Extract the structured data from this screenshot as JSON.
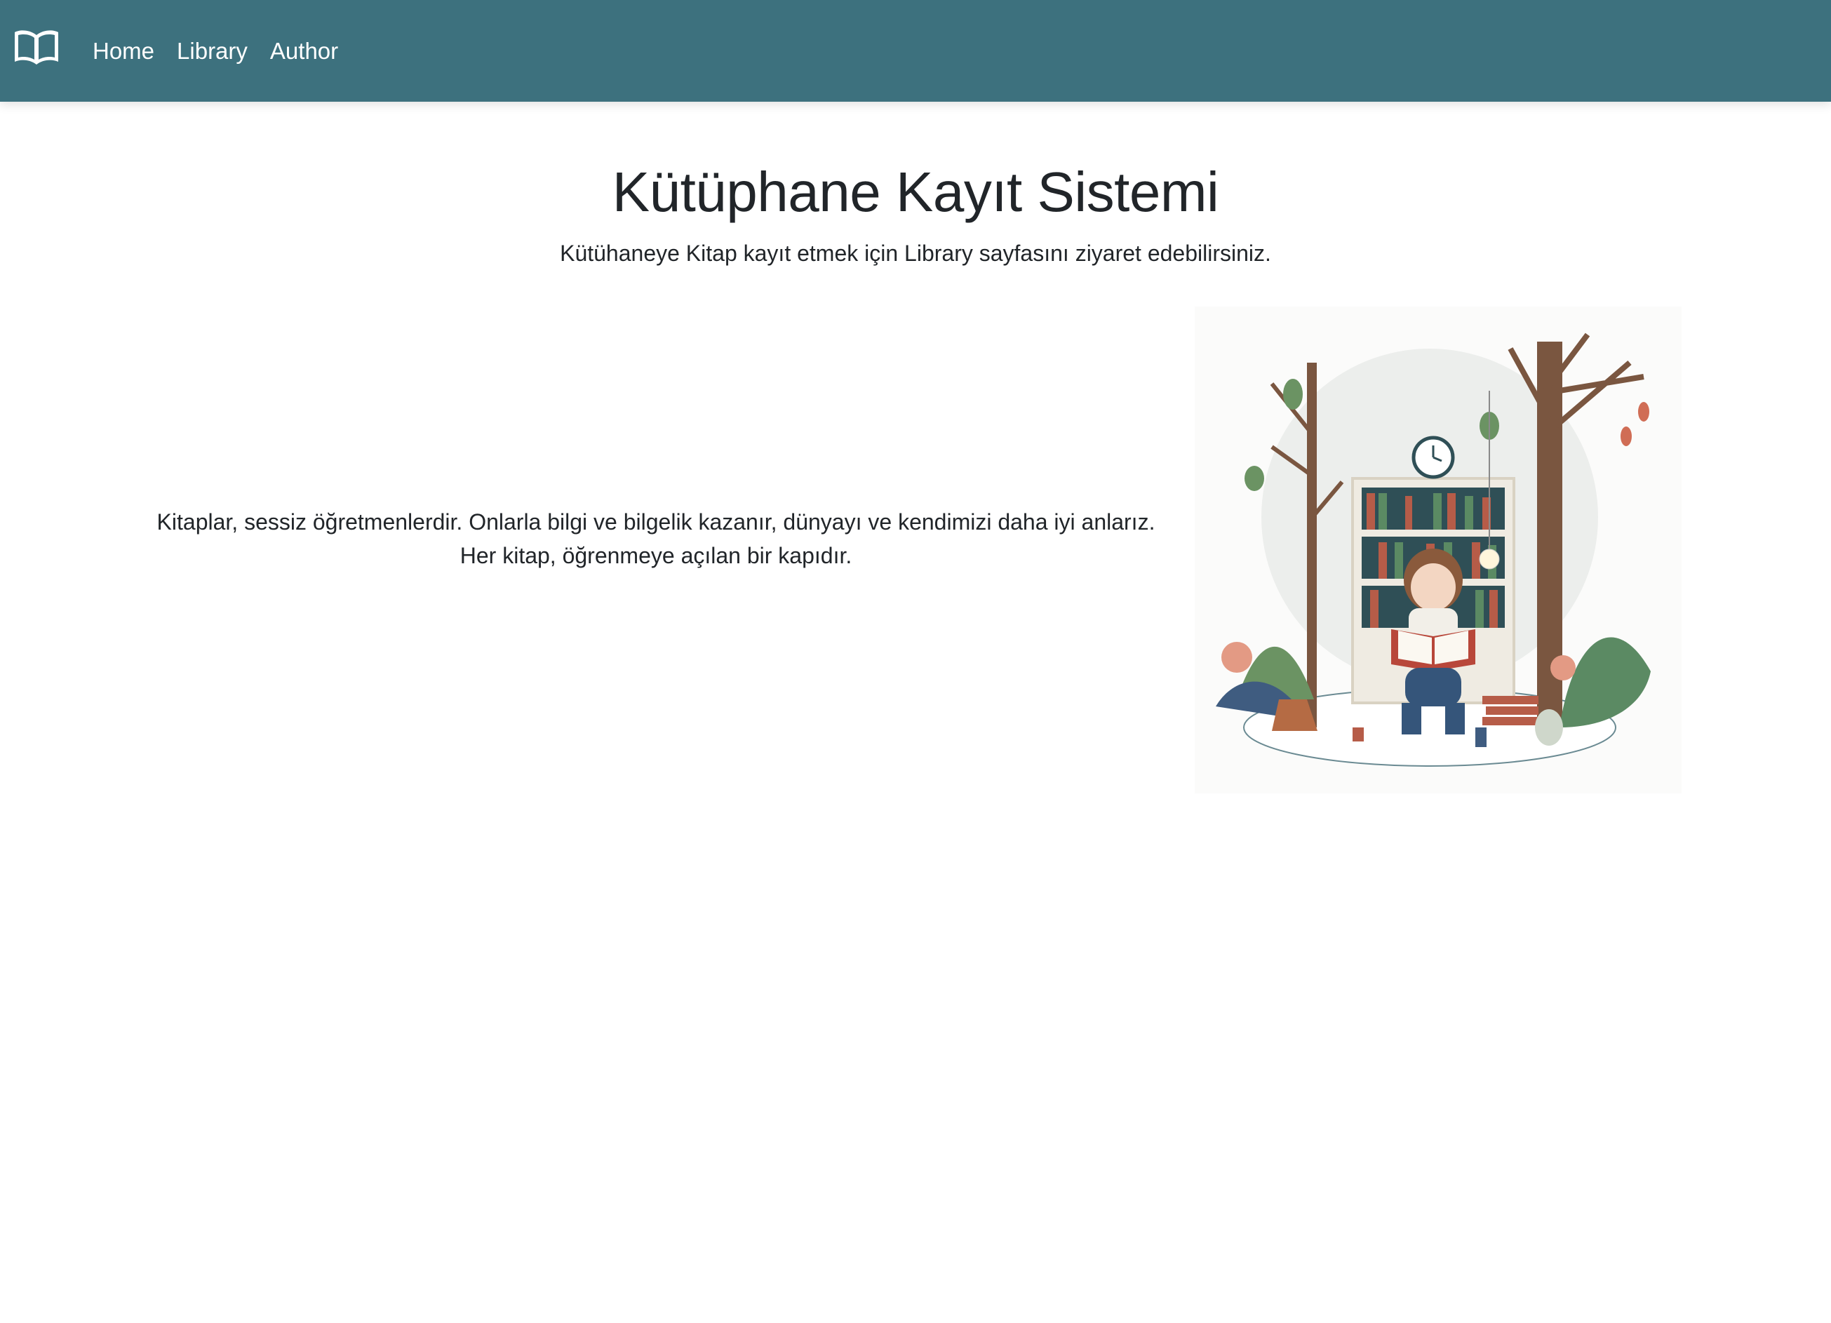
{
  "navbar": {
    "brand_icon": "open-book-icon",
    "links": [
      {
        "label": "Home"
      },
      {
        "label": "Library"
      },
      {
        "label": "Author"
      }
    ],
    "background": "#3d717e"
  },
  "main": {
    "title": "Kütüphane Kayıt Sistemi",
    "subtitle": "Kütühaneye Kitap kayıt etmek için Library sayfasını ziyaret edebilirsiniz.",
    "quote_line1": "Kitaplar, sessiz öğretmenlerdir. Onlarla bilgi ve bilgelik kazanır, dünyayı ve kendimizi daha iyi anlarız.",
    "quote_line2": "Her kitap, öğrenmeye açılan bir kapıdır.",
    "illustration": "girl-reading-in-forest-library-illustration"
  }
}
